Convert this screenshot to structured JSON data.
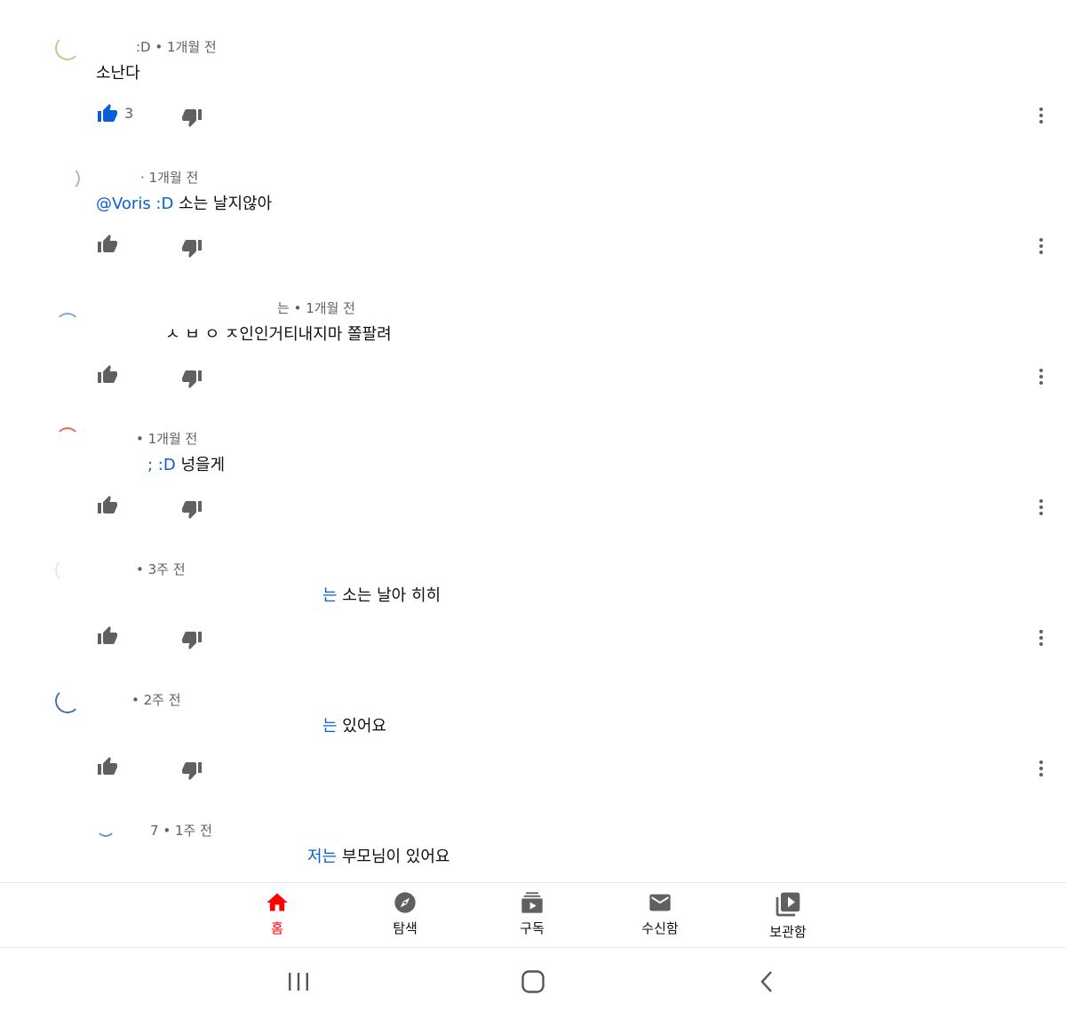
{
  "comments": [
    {
      "author": ":D",
      "time": "1개월 전",
      "mention": "",
      "text": "소난다",
      "likes": "3",
      "liked": true,
      "avatar_color": "#c9c28a"
    },
    {
      "author": "",
      "time": "1개월 전",
      "mention": "@Voris :D",
      "text": " 소는 날지않아",
      "likes": "",
      "liked": false,
      "avatar_color": "#9fb8d6"
    },
    {
      "author": "는",
      "time": "1개월 전",
      "mention": "",
      "text": "ㅅ ㅂ ㅇ ㅈ인인거티내지마 쫄팔려",
      "likes": "",
      "liked": false,
      "avatar_color": "#7aa7d8"
    },
    {
      "author": "",
      "time": "1개월 전",
      "mention": "; :D",
      "text": " 넝을게",
      "likes": "",
      "liked": false,
      "avatar_color": "#e0664a"
    },
    {
      "author": "",
      "time": "3주 전",
      "mention": "는",
      "text": " 소는 날아 히히",
      "likes": "",
      "liked": false,
      "avatar_color": "#d9d9d9"
    },
    {
      "author": "",
      "time": "2주 전",
      "mention": "는",
      "text": " 있어요",
      "likes": "",
      "liked": false,
      "avatar_color": "#4a6aa0"
    },
    {
      "author": "7",
      "time": "1주 전",
      "mention": "저는",
      "text": " 부모님이 있어요",
      "likes": "",
      "liked": false,
      "avatar_color": "#6a8ec8"
    }
  ],
  "bottom_nav": {
    "items": [
      {
        "label": "홈",
        "icon": "home-icon",
        "active": true
      },
      {
        "label": "탐색",
        "icon": "explore-icon",
        "active": false
      },
      {
        "label": "구독",
        "icon": "subscriptions-icon",
        "active": false
      },
      {
        "label": "수신함",
        "icon": "inbox-icon",
        "active": false
      },
      {
        "label": "보관함",
        "icon": "library-icon",
        "active": false
      }
    ]
  },
  "system_nav": {
    "recents": "recent-apps-icon",
    "home": "home-circle-icon",
    "back": "back-icon"
  },
  "colors": {
    "like_active": "#065fd4",
    "icon_gray": "#606060",
    "mention": "#065fd4",
    "nav_active": "#ff0000"
  }
}
